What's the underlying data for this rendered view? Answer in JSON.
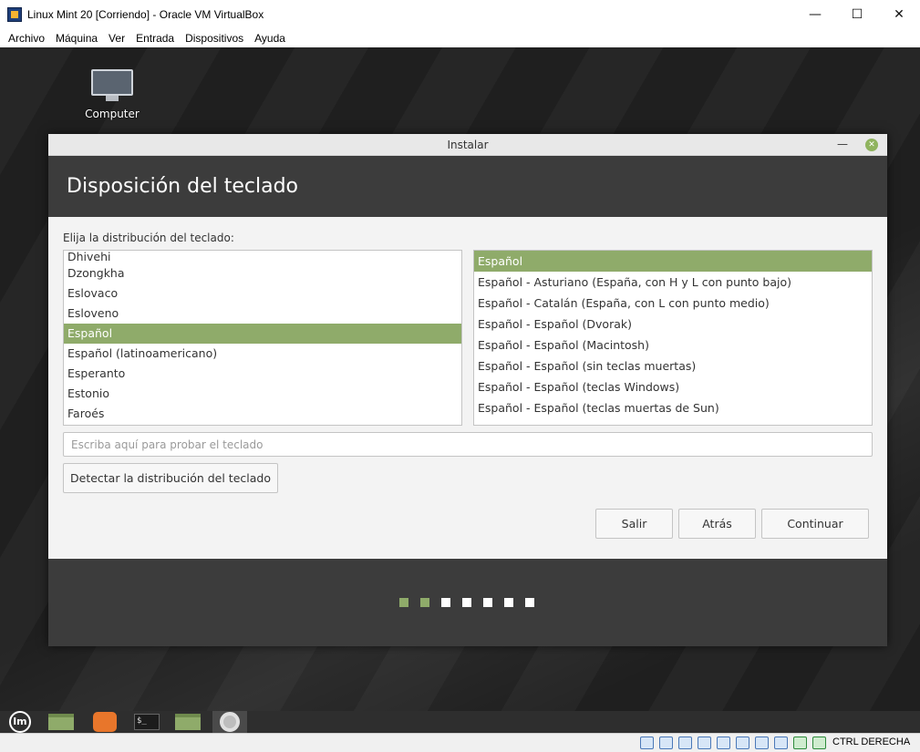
{
  "vbox": {
    "title": "Linux Mint 20 [Corriendo] - Oracle VM VirtualBox",
    "menu": [
      "Archivo",
      "Máquina",
      "Ver",
      "Entrada",
      "Dispositivos",
      "Ayuda"
    ],
    "host_key": "CTRL DERECHA"
  },
  "desktop": {
    "icon_label": "Computer"
  },
  "installer": {
    "window_title": "Instalar",
    "heading": "Disposición del teclado",
    "prompt": "Elija la distribución del teclado:",
    "layouts": [
      "Dhivehi",
      "Dzongkha",
      "Eslovaco",
      "Esloveno",
      "Español",
      "Español (latinoamericano)",
      "Esperanto",
      "Estonio",
      "Faroés"
    ],
    "selected_layout": "Español",
    "variants": [
      "Español",
      "Español - Asturiano (España, con H y L con punto bajo)",
      "Español - Catalán (España, con L con punto medio)",
      "Español - Español (Dvorak)",
      "Español - Español (Macintosh)",
      "Español - Español (sin teclas muertas)",
      "Español - Español (teclas Windows)",
      "Español - Español (teclas muertas de Sun)"
    ],
    "selected_variant": "Español",
    "test_placeholder": "Escriba aquí para probar el teclado",
    "detect_button": "Detectar la distribución del teclado",
    "quit_button": "Salir",
    "back_button": "Atrás",
    "continue_button": "Continuar",
    "progress": {
      "completed_steps": 2,
      "total_steps": 7
    },
    "accent_color": "#8fab6a"
  }
}
